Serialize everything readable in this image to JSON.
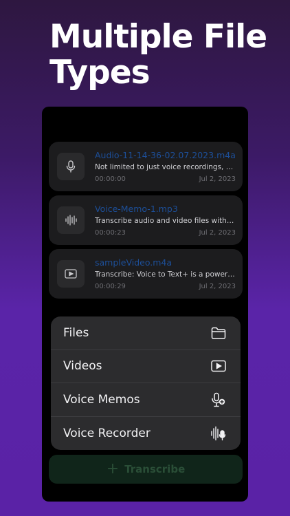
{
  "headline": "Multiple File Types",
  "files": [
    {
      "name": "Audio-11-14-36-02.07.2023.m4a",
      "description": "Not limited to just voice recordings, Tran...",
      "duration": "00:00:00",
      "date": "Jul 2, 2023",
      "icon": "microphone-icon"
    },
    {
      "name": "Voice-Memo-1.mp3",
      "description": "Transcribe audio and video files with eas...",
      "duration": "00:00:23",
      "date": "Jul 2, 2023",
      "icon": "waveform-icon"
    },
    {
      "name": "sampleVideo.m4a",
      "description": "Transcribe: Voice to Text+ is a powerful a...",
      "duration": "00:00:29",
      "date": "Jul 2, 2023",
      "icon": "play-rectangle-icon"
    }
  ],
  "menu": [
    {
      "label": "Files",
      "icon": "folder-icon"
    },
    {
      "label": "Videos",
      "icon": "play-rectangle-icon"
    },
    {
      "label": "Voice Memos",
      "icon": "mic-plus-icon"
    },
    {
      "label": "Voice Recorder",
      "icon": "waveform-mic-icon"
    }
  ],
  "transcribe_label": "Transcribe",
  "colors": {
    "accent": "#5a24a8",
    "title_link": "#1d4f99",
    "button_bg": "#10251a"
  }
}
